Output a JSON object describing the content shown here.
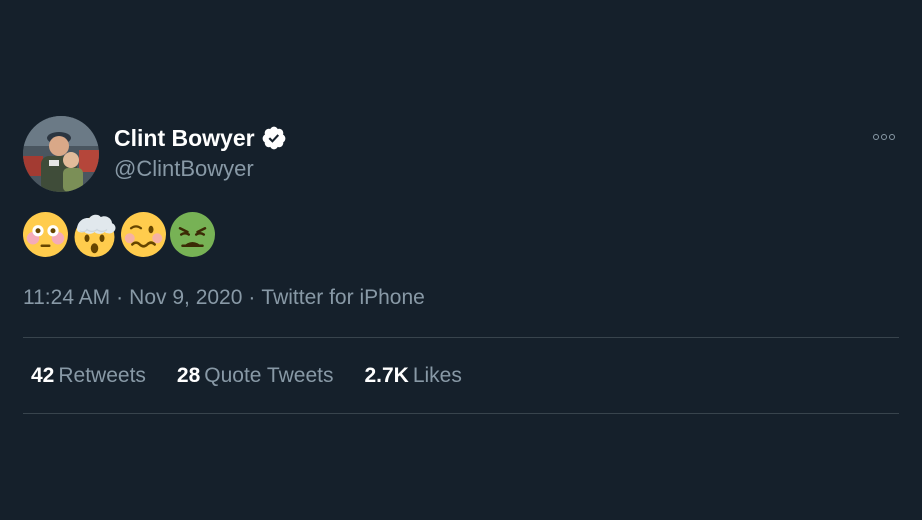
{
  "tweet": {
    "author": {
      "display_name": "Clint Bowyer",
      "handle": "@ClintBowyer",
      "verified": true,
      "avatar_icon": "profile-photo"
    },
    "more_icon": "ellipsis-icon",
    "emojis": [
      "flushed-face",
      "exploding-head",
      "woozy-face",
      "nauseated-face"
    ],
    "time": "11:24 AM",
    "date": "Nov 9, 2020",
    "source": "Twitter for iPhone",
    "separator": "·",
    "stats": {
      "retweets": {
        "count": "42",
        "label": "Retweets"
      },
      "quotes": {
        "count": "28",
        "label": "Quote Tweets"
      },
      "likes": {
        "count": "2.7K",
        "label": "Likes"
      }
    }
  },
  "colors": {
    "background": "#15202b",
    "text_primary": "#ffffff",
    "text_secondary": "#8899a6",
    "divider": "#38444d",
    "verified_badge": "#ffffff"
  }
}
